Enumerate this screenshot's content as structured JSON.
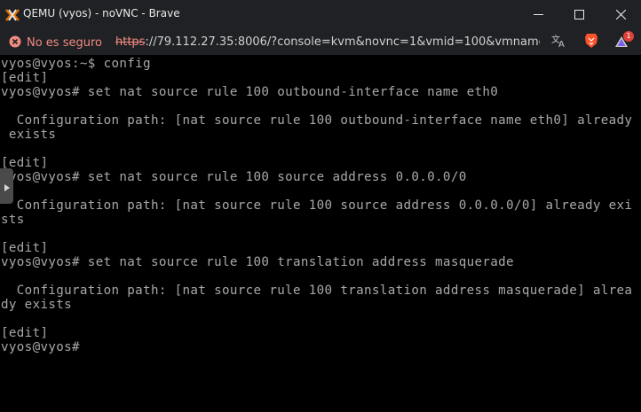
{
  "window": {
    "title": "QEMU (vyos) - noVNC - Brave"
  },
  "addressbar": {
    "security_label": "No es seguro",
    "url_scheme": "https",
    "url_rest": "://79.112.27.35:8006/?console=kvm&novnc=1&vmid=100&vmname=...",
    "badge_count": "1"
  },
  "colors": {
    "titlebar_bg": "#202124",
    "terminal_bg": "#000000",
    "terminal_fg": "#a8a8a8",
    "insecure_red": "#f28b82"
  },
  "icons": {
    "app": "proxmox-x-icon",
    "minimize": "minimize-icon",
    "maximize": "maximize-icon",
    "close": "close-icon",
    "security": "warning-circle-icon",
    "translate": "translate-icon",
    "brave_shield": "brave-lion-icon",
    "brave_rewards": "brave-triangle-icon",
    "novnc_handle": "chevron-right-icon"
  },
  "terminal": {
    "lines": [
      "vyos@vyos:~$ config",
      "[edit]",
      "vyos@vyos# set nat source rule 100 outbound-interface name eth0",
      "",
      "  Configuration path: [nat source rule 100 outbound-interface name eth0] already",
      " exists",
      "",
      "[edit]",
      "vyos@vyos# set nat source rule 100 source address 0.0.0.0/0",
      "",
      "  Configuration path: [nat source rule 100 source address 0.0.0.0/0] already exi",
      "sts",
      "",
      "[edit]",
      "vyos@vyos# set nat source rule 100 translation address masquerade",
      "",
      "  Configuration path: [nat source rule 100 translation address masquerade] alrea",
      "dy exists",
      "",
      "[edit]",
      "vyos@vyos#"
    ]
  }
}
